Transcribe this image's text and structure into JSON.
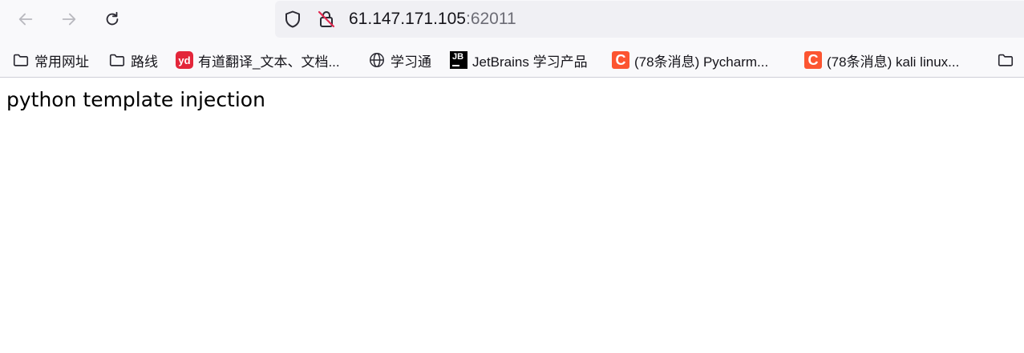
{
  "address_bar": {
    "host": "61.147.171.105",
    "port": ":62011"
  },
  "bookmarks": [
    {
      "label": "常用网址",
      "icon": "folder-icon"
    },
    {
      "label": "路线",
      "icon": "folder-icon"
    },
    {
      "label": "有道翻译_文本、文档...",
      "icon": "youdao-icon",
      "icon_text": "yd"
    },
    {
      "label": "学习通",
      "icon": "globe-icon"
    },
    {
      "label": "JetBrains 学习产品",
      "icon": "jetbrains-icon",
      "icon_text": "JB"
    },
    {
      "label": "(78条消息) Pycharm...",
      "icon": "csdn-icon",
      "icon_text": "C"
    },
    {
      "label": "(78条消息) kali linux...",
      "icon": "csdn-icon",
      "icon_text": "C"
    }
  ],
  "page": {
    "text": "python template injection"
  },
  "colors": {
    "toolbar_bg": "#f9f9fb",
    "urlbar_bg": "#f0f0f4",
    "youdao_red": "#e3263a",
    "csdn_orange": "#fc5531"
  }
}
